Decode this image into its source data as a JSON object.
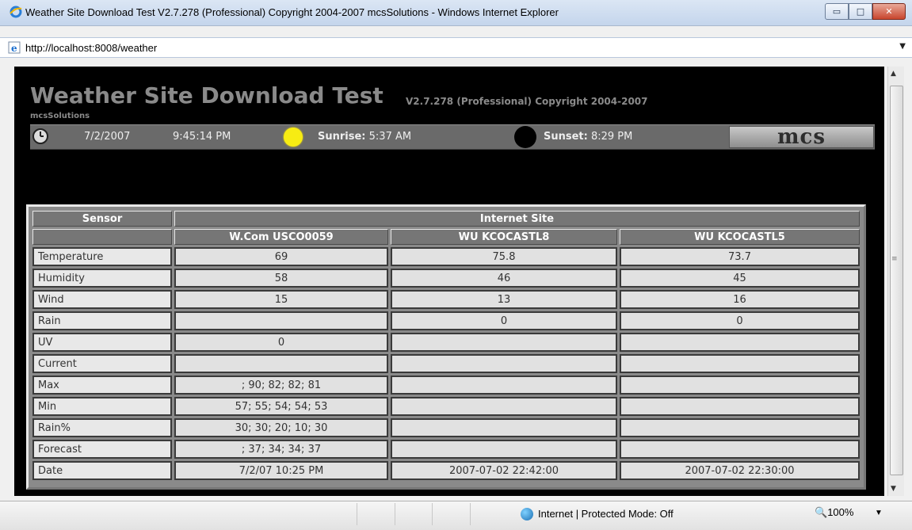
{
  "window": {
    "title": "Weather Site Download Test V2.7.278 (Professional) Copyright 2004-2007 mcsSolutions - Windows Internet Explorer",
    "minimize": "▭",
    "maximize": "□",
    "close": "✕"
  },
  "address": {
    "url": "http://localhost:8008/weather"
  },
  "page": {
    "title": "Weather Site Download Test",
    "version": "V2.7.278 (Professional) Copyright 2004-2007",
    "company": "mcsSolutions",
    "date": "7/2/2007",
    "time": "9:45:14 PM",
    "sunrise_label": "Sunrise:",
    "sunrise": "5:37 AM",
    "sunset_label": "Sunset:",
    "sunset": "8:29 PM",
    "logo": "mcs"
  },
  "table": {
    "header_sensor": "Sensor",
    "header_site": "Internet Site",
    "sites": [
      "W.Com USCO0059",
      "WU KCOCASTL8",
      "WU KCOCASTL5"
    ],
    "rows": [
      [
        "Temperature",
        "69",
        "75.8",
        "73.7"
      ],
      [
        "Humidity",
        "58",
        "46",
        "45"
      ],
      [
        "Wind",
        "15",
        "13",
        "16"
      ],
      [
        "Rain",
        "",
        "0",
        "0"
      ],
      [
        "UV",
        "0",
        "",
        ""
      ],
      [
        "Current",
        "",
        "",
        ""
      ],
      [
        "Max",
        "; 90; 82; 82; 81",
        "",
        ""
      ],
      [
        "Min",
        "57; 55; 54; 54; 53",
        "",
        ""
      ],
      [
        "Rain%",
        "30; 30; 20; 10; 30",
        "",
        ""
      ],
      [
        "Forecast",
        "; 37; 34; 34; 37",
        "",
        ""
      ],
      [
        "Date",
        "7/2/07 10:25 PM",
        "2007-07-02 22:42:00",
        "2007-07-02 22:30:00"
      ]
    ]
  },
  "status": {
    "zone": "Internet | Protected Mode: Off",
    "zoom": "100%"
  },
  "colors": {
    "content_bg": "#000000",
    "header_bg": "#767676",
    "cell_bg": "#e1e1e1",
    "sun": "#f7ec13"
  }
}
